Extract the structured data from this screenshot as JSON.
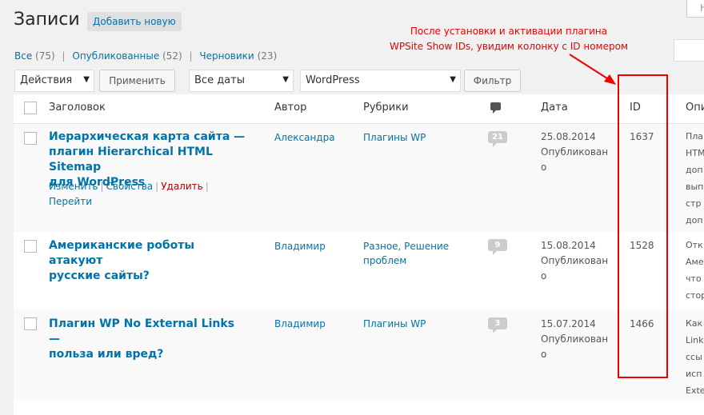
{
  "header": {
    "title": "Записи",
    "add_new": "Добавить новую",
    "top_right_partial": "Н"
  },
  "filters": {
    "all": "Все",
    "all_count": "(75)",
    "published": "Опубликованные",
    "published_count": "(52)",
    "drafts": "Черновики",
    "drafts_count": "(23)",
    "sep": "|"
  },
  "toolbar": {
    "bulk_actions": "Действия",
    "apply": "Применить",
    "dates": "Все даты",
    "category": "WordPress",
    "filter": "Фильтр"
  },
  "columns": {
    "title": "Заголовок",
    "author": "Автор",
    "categories": "Рубрики",
    "date": "Дата",
    "id": "ID",
    "excerpt_partial": "Опи"
  },
  "annotation": {
    "line1": "После установки и активации плагина",
    "line2": "WPSite Show IDs, увидим колонку с ID номером"
  },
  "rows": [
    {
      "title_l1": "Иерархическая карта сайта —",
      "title_l2": "плагин Hierarchical HTML Sitemap",
      "title_l3": "для WordPress",
      "author": "Александра",
      "categories_l1": "Плагины WP",
      "comments": "21",
      "date": "25.08.2014",
      "status_l1": "Опубликован",
      "status_l2": "о",
      "id": "1637",
      "excerpt": [
        "Пла",
        "HTM",
        "доп",
        "вып",
        "стр",
        "доп"
      ],
      "actions": {
        "edit": "Изменить",
        "props": "Свойства",
        "delete": "Удалить",
        "view": "Перейти"
      }
    },
    {
      "title_l1": "Американские роботы атакуют",
      "title_l2": "русские сайты?",
      "author": "Владимир",
      "categories_l1": "Разное, Решение",
      "categories_l2": "проблем",
      "comments": "9",
      "date": "15.08.2014",
      "status_l1": "Опубликован",
      "status_l2": "о",
      "id": "1528",
      "excerpt": [
        "Отк",
        "Аме",
        "что",
        "стор"
      ]
    },
    {
      "title_l1": "Плагин WP No External Links —",
      "title_l2": "польза или вред?",
      "author": "Владимир",
      "categories_l1": "Плагины WP",
      "comments": "3",
      "date": "15.07.2014",
      "status_l1": "Опубликован",
      "status_l2": "о",
      "id": "1466",
      "excerpt": [
        "Как",
        "Link",
        "ссы",
        "исп",
        "Exte"
      ]
    }
  ],
  "colors": {
    "link": "#0073aa",
    "annotation": "#ee0000",
    "delete": "#aa0000"
  }
}
